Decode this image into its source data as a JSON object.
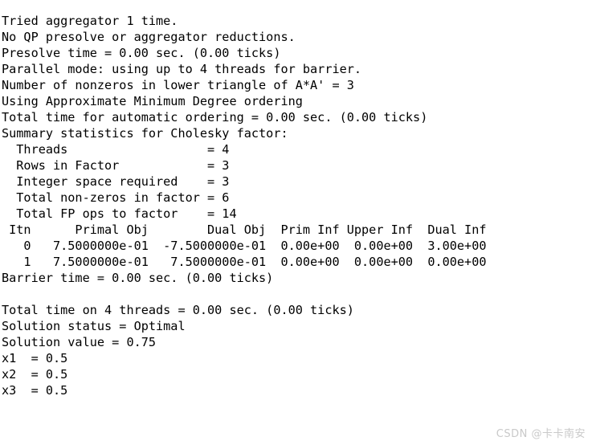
{
  "console": {
    "title": "CPLEX Barrier Solver Console Output",
    "background_color": "#ffffff",
    "text_color": "#000000",
    "lines": [
      "Tried aggregator 1 time.",
      "No QP presolve or aggregator reductions.",
      "Presolve time = 0.00 sec. (0.00 ticks)",
      "Parallel mode: using up to 4 threads for barrier.",
      "Number of nonzeros in lower triangle of A*A' = 3",
      "Using Approximate Minimum Degree ordering",
      "Total time for automatic ordering = 0.00 sec. (0.00 ticks)",
      "Summary statistics for Cholesky factor:",
      "  Threads                   = 4",
      "  Rows in Factor            = 3",
      "  Integer space required    = 3",
      "  Total non-zeros in factor = 6",
      "  Total FP ops to factor    = 14",
      " Itn      Primal Obj        Dual Obj  Prim Inf Upper Inf  Dual Inf",
      "   0   7.5000000e-01  -7.5000000e-01  0.00e+00  0.00e+00  3.00e+00",
      "   1   7.5000000e-01   7.5000000e-01  0.00e+00  0.00e+00  0.00e+00",
      "Barrier time = 0.00 sec. (0.00 ticks)",
      "",
      "Total time on 4 threads = 0.00 sec. (0.00 ticks)",
      "Solution status = Optimal",
      "Solution value = 0.75",
      "x1  = 0.5",
      "x2  = 0.5",
      "x3  = 0.5"
    ],
    "presolve": {
      "aggregator_times": "1",
      "presolve_time_sec": "0.00",
      "presolve_ticks": "0.00",
      "threads_for_barrier": "4",
      "nonzeros_lower_triangle": "3",
      "ordering_method": "Approximate Minimum Degree",
      "ordering_time_sec": "0.00",
      "ordering_ticks": "0.00"
    },
    "cholesky_summary": {
      "header": "Summary statistics for Cholesky factor:",
      "rows": [
        {
          "label": "Threads",
          "value": "4"
        },
        {
          "label": "Rows in Factor",
          "value": "3"
        },
        {
          "label": "Integer space required",
          "value": "3"
        },
        {
          "label": "Total non-zeros in factor",
          "value": "6"
        },
        {
          "label": "Total FP ops to factor",
          "value": "14"
        }
      ]
    },
    "iteration_table": {
      "columns": [
        "Itn",
        "Primal Obj",
        "Dual Obj",
        "Prim Inf",
        "Upper Inf",
        "Dual Inf"
      ],
      "rows": [
        [
          "0",
          "7.5000000e-01",
          "-7.5000000e-01",
          "0.00e+00",
          "0.00e+00",
          "3.00e+00"
        ],
        [
          "1",
          "7.5000000e-01",
          "7.5000000e-01",
          "0.00e+00",
          "0.00e+00",
          "0.00e+00"
        ]
      ]
    },
    "timing": {
      "barrier_time_sec": "0.00",
      "barrier_ticks": "0.00",
      "total_threads": "4",
      "total_time_sec": "0.00",
      "total_ticks": "0.00"
    },
    "solution": {
      "status_label": "Solution status",
      "status_value": "Optimal",
      "value_label": "Solution value",
      "value": "0.75",
      "variables": [
        {
          "name": "x1",
          "value": "0.5"
        },
        {
          "name": "x2",
          "value": "0.5"
        },
        {
          "name": "x3",
          "value": "0.5"
        }
      ]
    }
  },
  "watermark": {
    "text": "CSDN @卡卡南安",
    "color": "#c9c9c9"
  }
}
